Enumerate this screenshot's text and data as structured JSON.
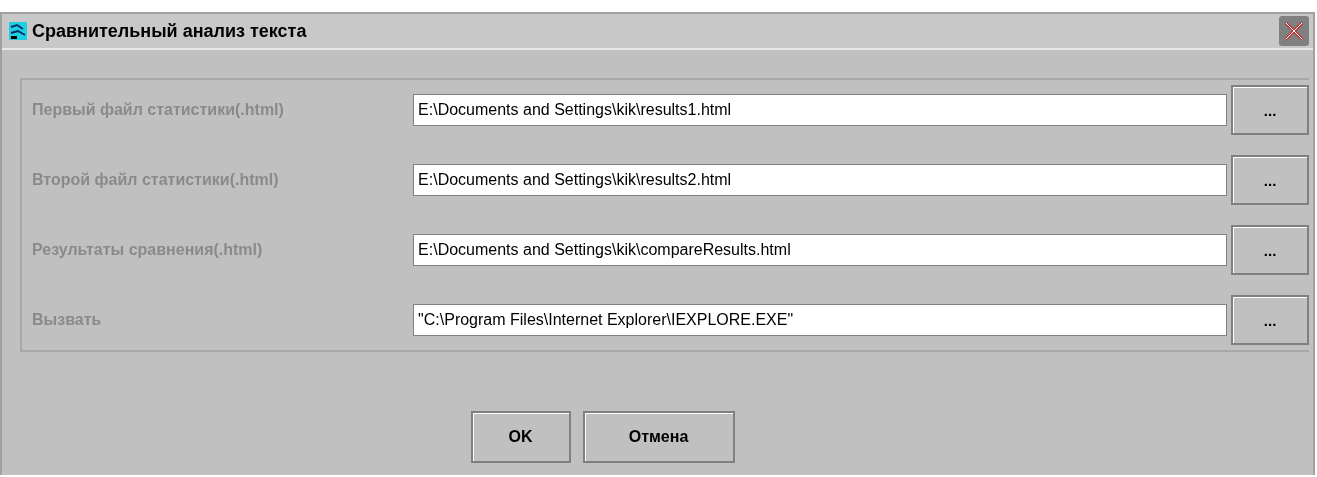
{
  "window": {
    "title": "Сравнительный анализ текста"
  },
  "fields": [
    {
      "label": "Первый файл статистики(.html)",
      "value": "E:\\Documents and Settings\\kik\\results1.html",
      "browse": "..."
    },
    {
      "label": "Второй файл статистики(.html)",
      "value": "E:\\Documents and Settings\\kik\\results2.html",
      "browse": "..."
    },
    {
      "label": "Результаты сравнения(.html)",
      "value": "E:\\Documents and Settings\\kik\\compareResults.html",
      "browse": "..."
    },
    {
      "label": "Вызвать",
      "value": "\"C:\\Program Files\\Internet Explorer\\IEXPLORE.EXE\"",
      "browse": "..."
    }
  ],
  "buttons": [
    "OK",
    "Отмена"
  ]
}
